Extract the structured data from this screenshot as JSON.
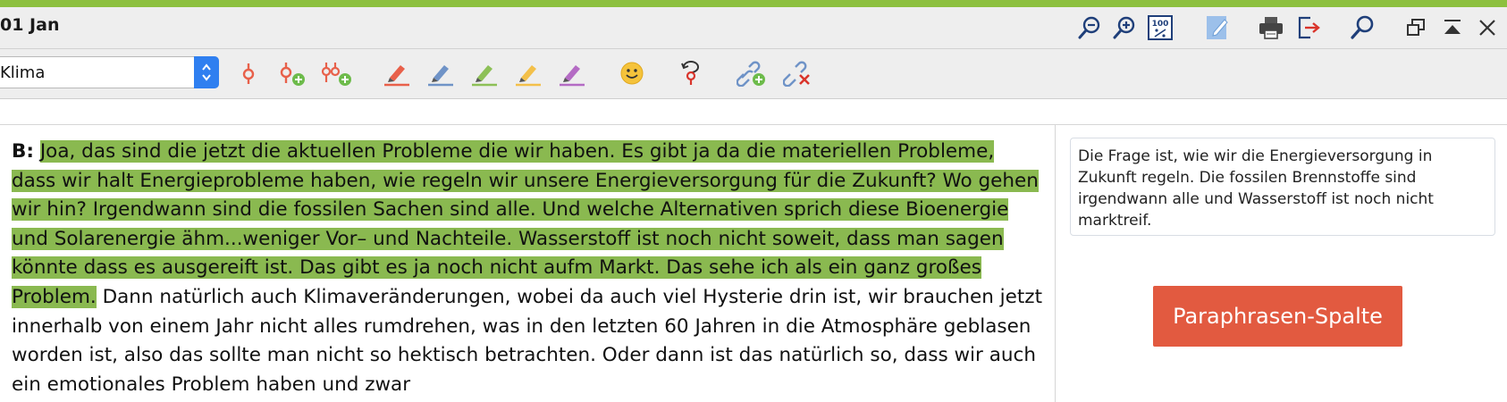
{
  "header": {
    "date_label": "01 Jan",
    "icons": [
      "zoom-out-icon",
      "zoom-in-icon",
      "zoom-100-icon",
      "edit-icon",
      "print-icon",
      "export-icon",
      "search-icon",
      "restore-window-icon",
      "collapse-icon",
      "close-icon"
    ],
    "zoom_100_text": "100"
  },
  "toolbar": {
    "code_value": "Klima",
    "tools": [
      "code-icon",
      "add-code-icon",
      "add-multiple-codes-icon",
      "highlighter-red-icon",
      "highlighter-blue-icon",
      "highlighter-green-icon",
      "highlighter-yellow-icon",
      "highlighter-purple-icon",
      "emoticon-icon",
      "undo-code-icon",
      "add-link-icon",
      "remove-link-icon"
    ]
  },
  "transcript": {
    "speaker": "B:",
    "highlighted_text": "Joa, das sind die jetzt die aktuellen Probleme die wir haben. Es gibt ja da die materiellen Probleme, dass wir halt Energieprobleme haben, wie regeln wir unsere Energieversorgung für die Zukunft? Wo gehen wir hin? Irgendwann sind die fossilen Sachen sind alle. Und welche Alternativen sprich diese Bioenergie und Solarenergie ähm...weniger Vor– und Nachteile. Wasserstoff ist noch nicht soweit, dass man sagen könnte dass es ausgereift ist. Das gibt es ja noch nicht aufm Markt. Das sehe ich als ein ganz großes Problem.",
    "rest_text": "Dann natürlich auch Klimaveränderungen, wobei da auch viel Hysterie drin ist, wir brauchen jetzt innerhalb von einem Jahr nicht alles rumdrehen, was in den letzten 60 Jahren in die Atmosphäre geblasen worden ist, also das sollte man nicht so hektisch betrachten. Oder dann ist das natürlich so, dass wir auch ein emotionales Problem haben und zwar"
  },
  "paraphrase": {
    "text": "Die Frage ist, wie wir die Energieversorgung in Zukunft regeln. Die fossilen Brennstoffe sind irgendwann alle und Wasserstoff ist noch nicht marktreif.",
    "button_label": "Paraphrasen-Spalte"
  },
  "colors": {
    "accent": "#8dc03f",
    "highlight": "#8ab950",
    "button": "#e25a40",
    "select_arrow": "#2f7ff0"
  }
}
